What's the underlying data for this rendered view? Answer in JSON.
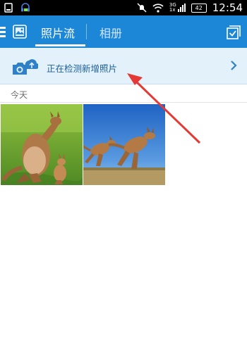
{
  "status_bar": {
    "time": "12:54",
    "battery": "42",
    "signal_top": "3G",
    "signal_bottom": "1x"
  },
  "header": {
    "tabs": [
      {
        "label": "照片流",
        "active": true
      },
      {
        "label": "相册",
        "active": false
      }
    ]
  },
  "banner": {
    "text": "正在检测新增照片",
    "chevron": "❯"
  },
  "section": {
    "label": "今天"
  },
  "photos": [
    {
      "subject": "kangaroo-mother-and-joey"
    },
    {
      "subject": "two-jumping-kangaroos"
    }
  ],
  "colors": {
    "header_bg": "#1d87d7",
    "banner_bg": "#e3f1fb",
    "banner_text": "#1b5f99",
    "annotation_arrow": "#e53935"
  },
  "icons": [
    "menu-icon",
    "photo-app-icon",
    "select-icon",
    "camera-upload-icon",
    "chevron-right-icon"
  ]
}
